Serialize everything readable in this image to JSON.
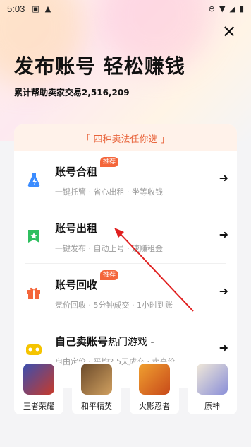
{
  "status_bar": {
    "time": "5:03"
  },
  "header": {
    "title": "发布账号 轻松赚钱",
    "subtitle": "累计帮助卖家交易2,516,209"
  },
  "card": {
    "banner": "「 四种卖法任你选 」",
    "options": [
      {
        "name": "账号合租",
        "badge": "推荐",
        "desc": "一键托管 · 省心出租 · 坐等收钱",
        "icon": "flask-icon",
        "color": "#3b8cff"
      },
      {
        "name": "账号出租",
        "badge": "",
        "desc": "一键发布 · 自动上号 · 速赚租金",
        "icon": "star-badge-icon",
        "color": "#2fbf5f"
      },
      {
        "name": "账号回收",
        "badge": "推荐",
        "desc": "竞价回收 · 5分钟成交 · 1小时到账",
        "icon": "gift-box-icon",
        "color": "#f4663b"
      },
      {
        "name": "自己卖账号",
        "badge": "",
        "extra": "热门游戏 -",
        "desc": "自由定价 · 平均2.5天成交 · 卖高价",
        "icon": "gamepad-icon",
        "color": "#f5c400"
      }
    ]
  },
  "games": [
    {
      "name": "王者荣耀",
      "color": "#c83a2a"
    },
    {
      "name": "和平精英",
      "color": "#a87a3a"
    },
    {
      "name": "火影忍者",
      "color": "#e88a1f"
    },
    {
      "name": "原神",
      "color": "#8a8fd8"
    }
  ]
}
